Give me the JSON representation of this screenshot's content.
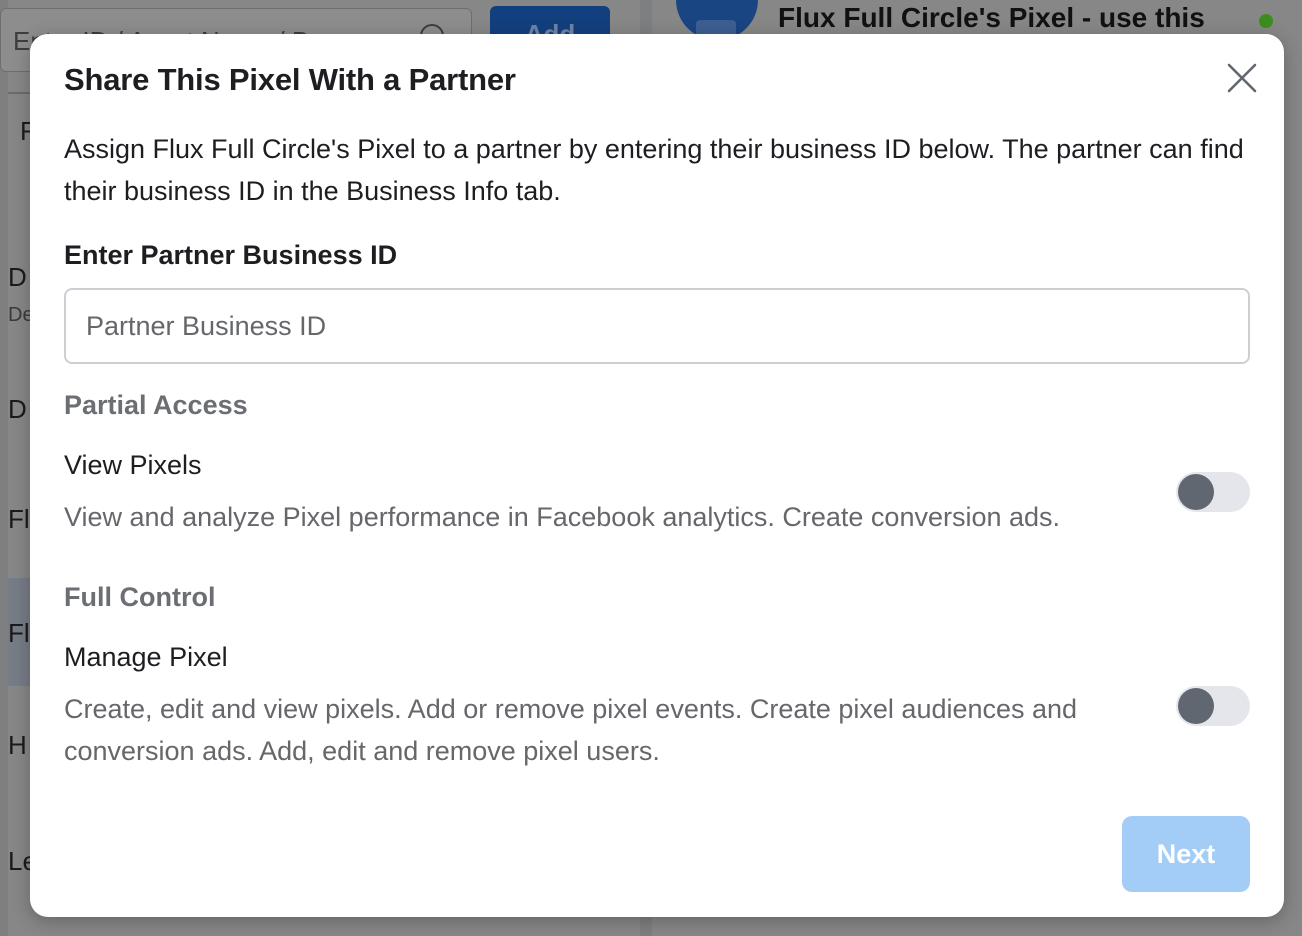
{
  "background": {
    "search_placeholder": "Enter ID / Asset Name / Bus",
    "add_label": "Add",
    "asset_title": "Flux Full Circle's Pixel - use this",
    "list_letters": [
      "F",
      "D",
      "De",
      "D",
      "Fl",
      "Fl",
      "H",
      "Le"
    ]
  },
  "modal": {
    "title": "Share This Pixel With a Partner",
    "description": "Assign Flux Full Circle's Pixel to a partner by entering their business ID below. The partner can find their business ID in the Business Info tab.",
    "field_label": "Enter Partner Business ID",
    "input_placeholder": "Partner Business ID",
    "input_value": "",
    "sections": [
      {
        "heading": "Partial Access",
        "permission_title": "View Pixels",
        "permission_description": "View and analyze Pixel performance in Facebook analytics. Create conversion ads.",
        "enabled": false
      },
      {
        "heading": "Full Control",
        "permission_title": "Manage Pixel",
        "permission_description": "Create, edit and view pixels. Add or remove pixel events. Create pixel audiences and conversion ads. Add, edit and remove pixel users.",
        "enabled": false
      }
    ],
    "next_label": "Next"
  },
  "colors": {
    "primary_disabled": "#a3cdf7",
    "toggle_off_track": "#e4e6eb",
    "toggle_off_knob": "#606770",
    "status_online": "#3c8d1f"
  }
}
